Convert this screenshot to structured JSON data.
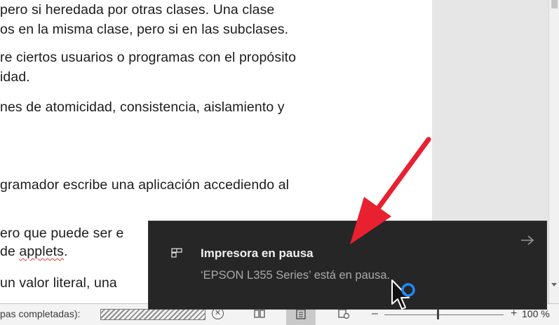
{
  "document": {
    "lines": [
      "pero si heredada por otras clases. Una clase",
      "os en la misma clase, pero si en las subclases.",
      "re ciertos usuarios o programas con el propósito",
      "idad.",
      "nes de atomicidad, consistencia, aislamiento y",
      "gramador escribe una aplicación accediendo al",
      "ero que puede ser e",
      "de ",
      "applets",
      ".",
      "un valor literal, una"
    ]
  },
  "statusbar": {
    "status_text": "pas completadas):",
    "zoom_label": "100 %"
  },
  "notification": {
    "title": "Impresora en pausa",
    "body": "‘EPSON L355 Series’ está en pausa.",
    "app_icon": "printer-queue-icon",
    "expand_icon": "arrow-right-icon"
  },
  "colors": {
    "toast_background": "#262626",
    "annotation_arrow": "#e8202f",
    "spellcheck_underline": "#e0342a",
    "cursor_ring": "#1e88ff"
  }
}
